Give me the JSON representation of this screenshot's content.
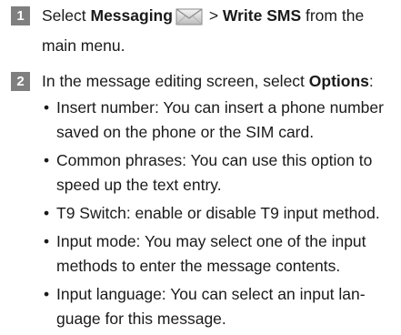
{
  "steps": [
    {
      "number": "1",
      "pre": "Select ",
      "bold1": "Messaging",
      "icon": "envelope-icon",
      "mid": " > ",
      "bold2": "Write SMS",
      "post": " from the main menu."
    },
    {
      "number": "2",
      "pre": "In the message editing screen, select ",
      "bold1": "Options",
      "post": ":",
      "items": [
        "Insert number: You can insert a phone number saved on the phone or the SIM card.",
        "Common phrases: You can use this option to speed up the text entry.",
        "T9 Switch: enable or disable T9 input method.",
        "Input mode: You may select one of the input methods to enter the message contents.",
        "Input language: You can select an input lan- guage for this message."
      ]
    }
  ]
}
